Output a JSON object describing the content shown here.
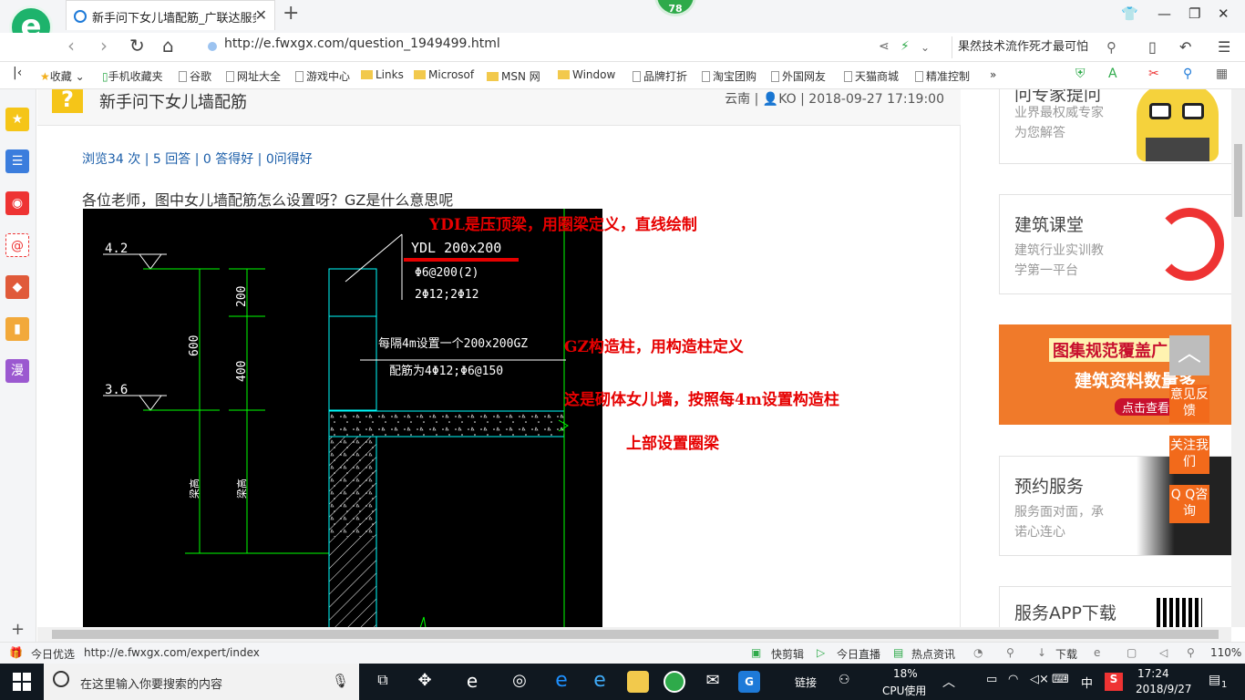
{
  "browser": {
    "tab_title": "新手问下女儿墙配筋_广联达服务",
    "badge": "78",
    "url": "http://e.fwxgx.com/question_1949499.html",
    "search_text": "果然技术流作死才最可怕"
  },
  "bookmarks": [
    "收藏",
    "手机收藏夹",
    "谷歌",
    "网址大全",
    "游戏中心",
    "Links",
    "Microsof",
    "MSN 网",
    "Window",
    "品牌打折",
    "淘宝团购",
    "外国网友",
    "天猫商城",
    "精准控制"
  ],
  "question": {
    "title": "新手问下女儿墙配筋",
    "region": "云南",
    "user": "KO",
    "time": "2018-09-27 17:19:00",
    "views": "浏览34 次",
    "answers": "5 回答",
    "good": "0 答得好",
    "asked_good": "0问得好",
    "body": "各位老师，图中女儿墙配筋怎么设置呀？GZ是什么意思呢"
  },
  "cad": {
    "elev_top": "4.2",
    "elev_bottom": "3.6",
    "dim_600": "600",
    "dim_200": "200",
    "dim_400": "400",
    "beam_label": "YDL 200x200",
    "beam_stirrup": "Φ6@200(2)",
    "beam_rebar": "2Φ12;2Φ12",
    "gz_label": "每隔4m设置一个200x200GZ",
    "gz_rebar": "配筋为4Φ12;Φ6@150",
    "vert_label_1": "梁高",
    "vert_label_2": "梁高"
  },
  "annotations": {
    "a1": "YDL是压顶梁，用圈梁定义，直线绘制",
    "a2": "GZ构造柱，用构造柱定义",
    "a3": "这是砌体女儿墙，按照每4m设置构造柱",
    "a4": "上部设置圈梁"
  },
  "right": {
    "expert_title": "问专家提问",
    "expert_sub1": "业界最权威专家",
    "expert_sub2": "为您解答",
    "course_title": "建筑课堂",
    "course_sub1": "建筑行业实训教",
    "course_sub2": "学第一平台",
    "banner_line1": "图集规范覆盖广",
    "banner_line2": "建筑资料数量多",
    "banner_btn": "点击查看",
    "service_title": "预约服务",
    "service_sub1": "服务面对面，承",
    "service_sub2": "诺心连心",
    "app_title": "服务APP下载"
  },
  "float_buttons": {
    "top": "︿",
    "feedback": "意见反馈",
    "follow": "关注我们",
    "qq": "Q Q咨询"
  },
  "status": {
    "today": "今日优选",
    "url": "http://e.fwxgx.com/expert/index",
    "quick": "快剪辑",
    "live": "今日直播",
    "news": "热点资讯",
    "download": "下载",
    "zoom": "110%"
  },
  "taskbar": {
    "search_placeholder": "在这里输入你要搜索的内容",
    "links": "链接",
    "cpu_pct": "18%",
    "cpu_label": "CPU使用",
    "ime": "中",
    "time": "17:24",
    "date": "2018/9/27",
    "notif": "1"
  }
}
